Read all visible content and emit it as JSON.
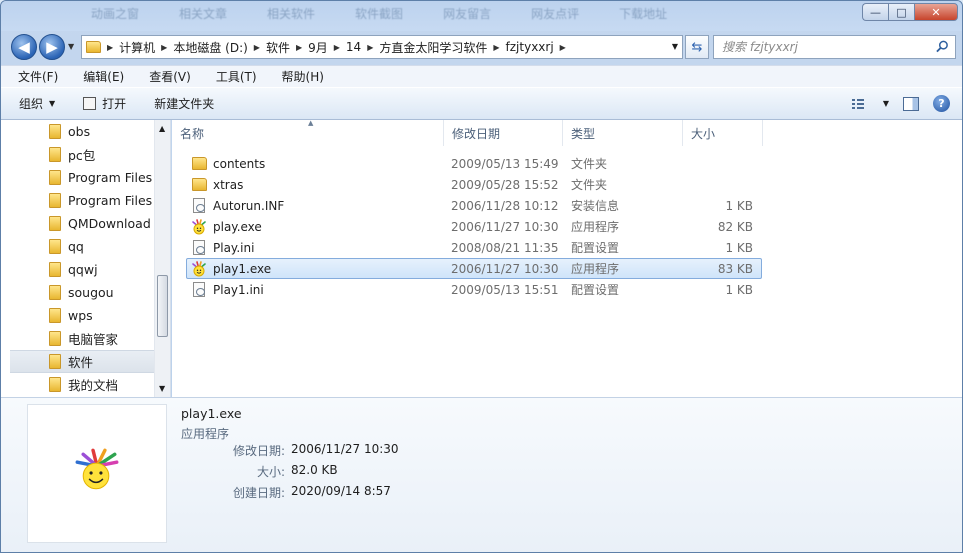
{
  "background_tabs": [
    "动画之窗",
    "相关文章",
    "相关软件",
    "软件截图",
    "网友留言",
    "网友点评",
    "下载地址"
  ],
  "window": {
    "min": "—",
    "max": "□",
    "close": "✕"
  },
  "nav": {
    "back": "◀",
    "forward": "▶"
  },
  "address": {
    "crumbs": [
      "计算机",
      "本地磁盘 (D:)",
      "软件",
      "9月",
      "14",
      "方直金太阳学习软件",
      "fzjtyxxrj"
    ]
  },
  "search": {
    "placeholder": "搜索 fzjtyxxrj"
  },
  "menubar": [
    "文件(F)",
    "编辑(E)",
    "查看(V)",
    "工具(T)",
    "帮助(H)"
  ],
  "cmdbar": {
    "organize": "组织",
    "open": "打开",
    "new_folder": "新建文件夹"
  },
  "navpane": {
    "items": [
      "obs",
      "pc包",
      "Program Files",
      "Program Files",
      "QMDownload",
      "qq",
      "qqwj",
      "sougou",
      "wps",
      "电脑管家",
      "软件",
      "我的文档"
    ],
    "selected_index": 10
  },
  "columns": {
    "name": "名称",
    "date": "修改日期",
    "type": "类型",
    "size": "大小"
  },
  "files": [
    {
      "name": "contents",
      "date": "2009/05/13 15:49",
      "type": "文件夹",
      "size": "",
      "icon": "folder"
    },
    {
      "name": "xtras",
      "date": "2009/05/28 15:52",
      "type": "文件夹",
      "size": "",
      "icon": "folder"
    },
    {
      "name": "Autorun.INF",
      "date": "2006/11/28 10:12",
      "type": "安装信息",
      "size": "1 KB",
      "icon": "ini"
    },
    {
      "name": "play.exe",
      "date": "2006/11/27 10:30",
      "type": "应用程序",
      "size": "82 KB",
      "icon": "sun"
    },
    {
      "name": "Play.ini",
      "date": "2008/08/21 11:35",
      "type": "配置设置",
      "size": "1 KB",
      "icon": "ini"
    },
    {
      "name": "play1.exe",
      "date": "2006/11/27 10:30",
      "type": "应用程序",
      "size": "83 KB",
      "icon": "sun"
    },
    {
      "name": "Play1.ini",
      "date": "2009/05/13 15:51",
      "type": "配置设置",
      "size": "1 KB",
      "icon": "ini"
    }
  ],
  "selected_file_index": 5,
  "details": {
    "name": "play1.exe",
    "type": "应用程序",
    "modified_label": "修改日期:",
    "modified": "2006/11/27 10:30",
    "size_label": "大小:",
    "size": "82.0 KB",
    "created_label": "创建日期:",
    "created": "2020/09/14 8:57"
  },
  "colors": {
    "accent": "#2b64b5",
    "selection": "#cfe4fa",
    "selection_border": "#84acdd"
  }
}
